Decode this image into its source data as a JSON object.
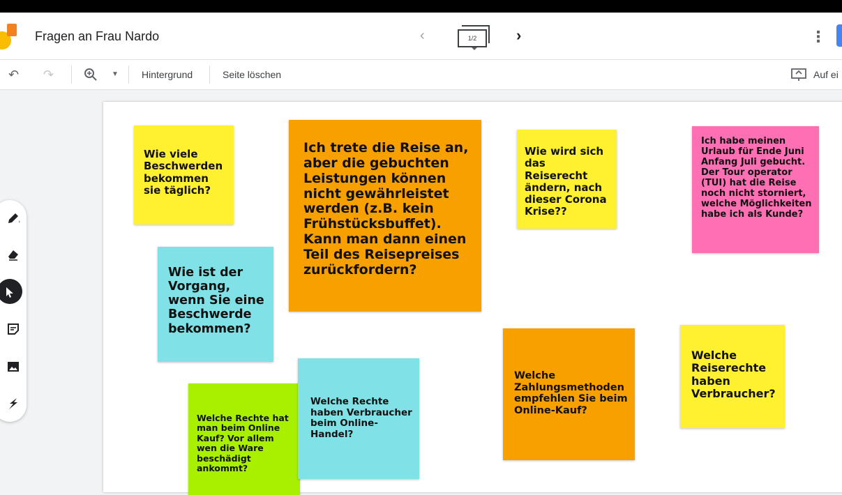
{
  "header": {
    "title": "Fragen an Frau Nardo",
    "page_indicator": "1/2",
    "prev_icon": "‹",
    "next_icon": "›",
    "menu_icon": "⋮"
  },
  "toolbar": {
    "background_label": "Hintergrund",
    "delete_page_label": "Seite löschen",
    "present_label": "Auf ei"
  },
  "tools": [
    "pen",
    "eraser",
    "select",
    "sticky-note",
    "image",
    "laser"
  ],
  "notes": [
    {
      "text": "Wie viele Beschwerden bekommen sie täglich?",
      "color": "#fff12f"
    },
    {
      "text": "Ich trete die Reise an, aber die gebuchten Leistungen können nicht gewährleistet werden (z.B. kein Frühstücksbuffet). Kann man dann einen Teil des Reisepreises zurückfordern?",
      "color": "#f7a000"
    },
    {
      "text": "Wie wird sich das Reiserecht ändern, nach dieser Corona Krise??",
      "color": "#fff12f"
    },
    {
      "text": "Ich habe meinen Urlaub für Ende Juni Anfang Juli gebucht. Der Tour operator (TUI) hat die Reise noch nicht storniert, welche Möglichkeiten habe ich als Kunde?",
      "color": "#ff6fb4"
    },
    {
      "text": "Wie ist der Vorgang, wenn Sie eine Beschwerde bekommen?",
      "color": "#80e2e6"
    },
    {
      "text": "Welche Rechte haben Verbraucher beim Online-Handel?",
      "color": "#80e2e6"
    },
    {
      "text": "Welche Rechte hat man beim Online Kauf? Vor allem wen die Ware beschädigt ankommt?",
      "color": "#a8f000"
    },
    {
      "text": "Welche Zahlungsmethoden empfehlen Sie beim Online-Kauf?",
      "color": "#f7a000"
    },
    {
      "text": "Welche Reiserechte haben Verbraucher?",
      "color": "#fff12f"
    }
  ]
}
